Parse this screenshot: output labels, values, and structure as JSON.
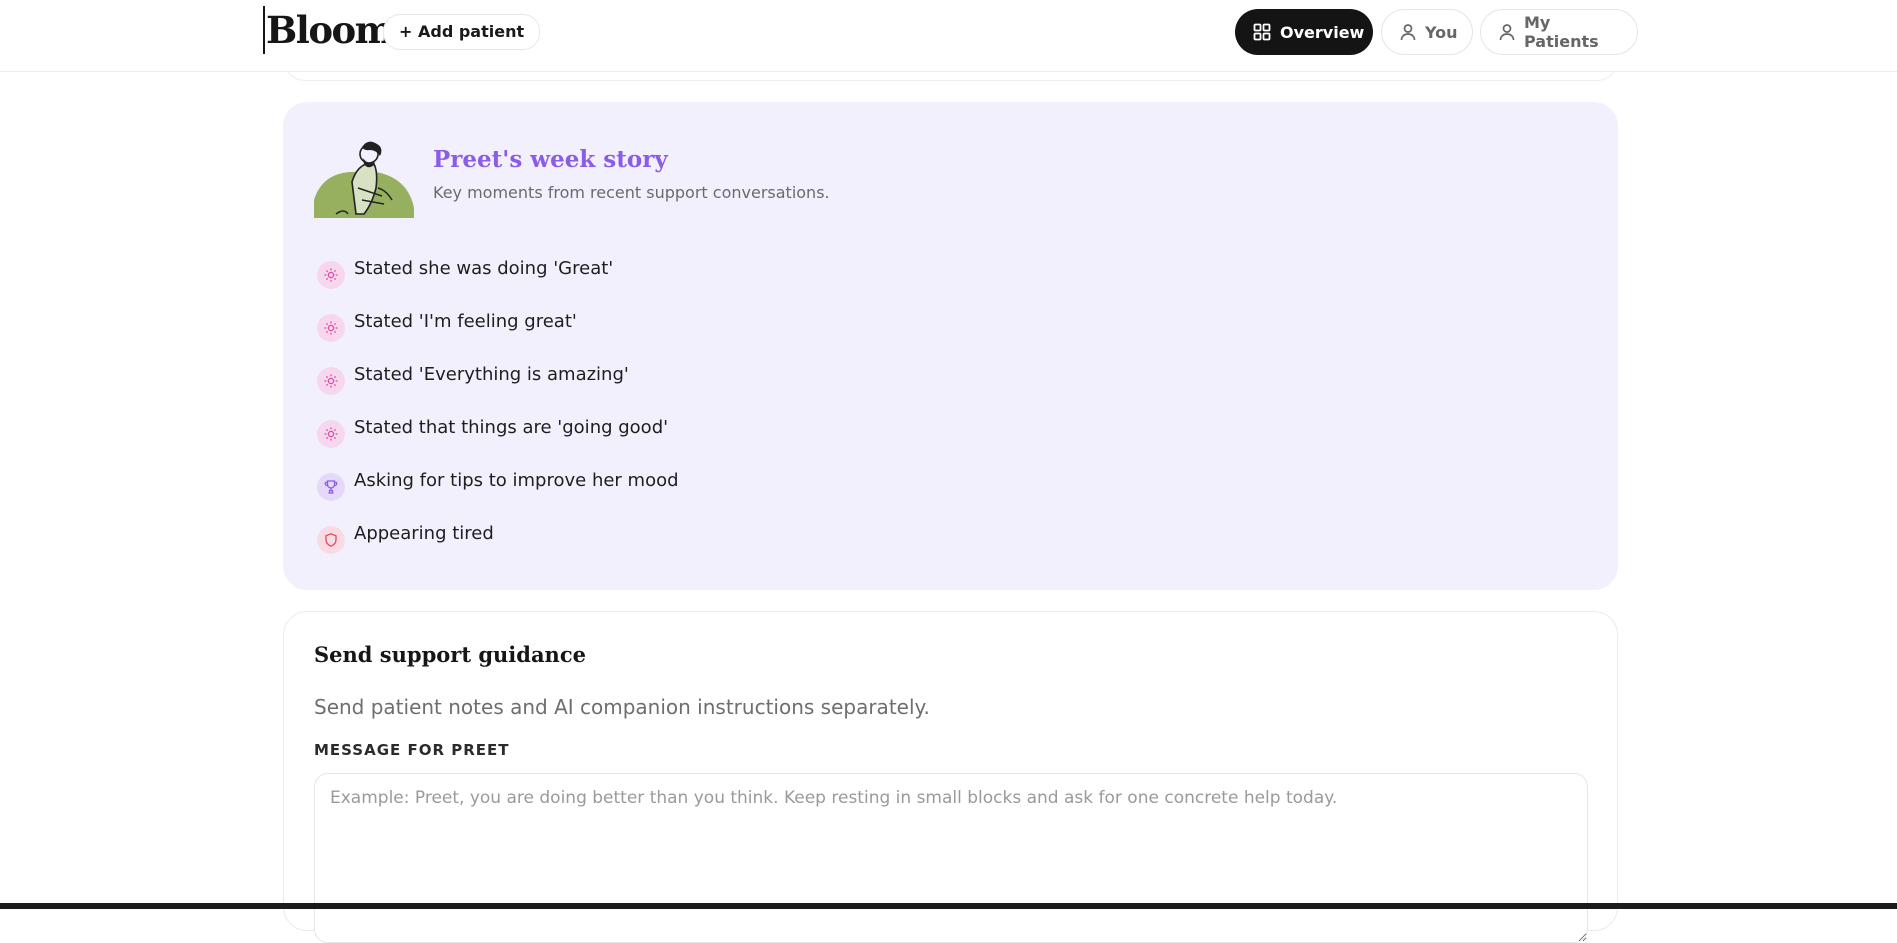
{
  "header": {
    "brand": "Bloom",
    "add_patient": "+ Add patient",
    "nav": [
      {
        "label": "Overview",
        "icon": "grid-icon",
        "active": true
      },
      {
        "label": "You",
        "icon": "user-icon",
        "active": false
      },
      {
        "label": "My Patients",
        "icon": "user-icon",
        "active": false
      }
    ]
  },
  "story": {
    "title": "Preet's week story",
    "subtitle": "Key moments from recent support conversations.",
    "items": [
      {
        "text": "Stated she was doing 'Great'",
        "icon": "sun-icon"
      },
      {
        "text": "Stated 'I'm feeling great'",
        "icon": "sun-icon"
      },
      {
        "text": "Stated 'Everything is amazing'",
        "icon": "sun-icon"
      },
      {
        "text": "Stated that things are 'going good'",
        "icon": "sun-icon"
      },
      {
        "text": "Asking for tips to improve her mood",
        "icon": "trophy-icon"
      },
      {
        "text": "Appearing tired",
        "icon": "shield-icon"
      }
    ]
  },
  "guidance": {
    "title": "Send support guidance",
    "subtitle": "Send patient notes and AI companion instructions separately.",
    "message_label": "MESSAGE FOR PREET",
    "message_value": "",
    "message_placeholder": "Example: Preet, you are doing better than you think. Keep resting in small blocks and ask for one concrete help today."
  },
  "colors": {
    "accent_purple": "#8b5ce8",
    "story_bg": "#f3f0fe",
    "sun_icon": "#d94aa6",
    "trophy_icon": "#8b5ce8",
    "shield_icon": "#e0485f"
  }
}
